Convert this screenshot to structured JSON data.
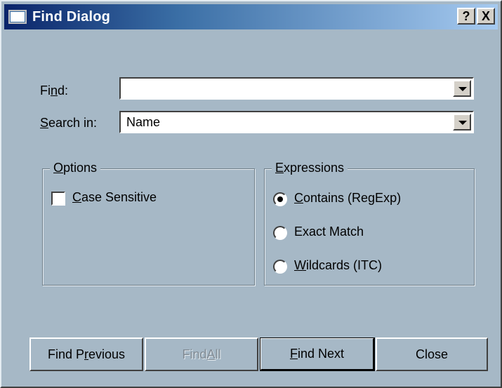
{
  "window": {
    "title": "Find Dialog",
    "help_glyph": "?",
    "close_glyph": "X"
  },
  "find": {
    "label_pre": "Fi",
    "label_accel": "n",
    "label_post": "d:",
    "value": ""
  },
  "search_in": {
    "label_pre": "",
    "label_accel": "S",
    "label_post": "earch in:",
    "value": "Name"
  },
  "options": {
    "title_accel": "O",
    "title_post": "ptions",
    "case_sensitive": {
      "label_accel": "C",
      "label_post": "ase Sensitive",
      "checked": false
    }
  },
  "expressions": {
    "title_accel": "E",
    "title_post": "xpressions",
    "items": [
      {
        "accel": "C",
        "rest": "ontains (RegExp)",
        "selected": true
      },
      {
        "accel": "",
        "rest": "Exact Match",
        "selected": false
      },
      {
        "accel": "W",
        "rest": "ildcards (ITC)",
        "selected": false
      }
    ]
  },
  "buttons": {
    "find_previous": {
      "pre": "Find P",
      "accel": "r",
      "post": "evious"
    },
    "find_all": {
      "pre": "Find ",
      "accel": "A",
      "post": "ll",
      "enabled": false
    },
    "find_next": {
      "pre": "",
      "accel": "F",
      "post": "ind Next"
    },
    "close": {
      "pre": "Close",
      "accel": "",
      "post": ""
    }
  },
  "colors": {
    "dialog_bg": "#a6b8c6",
    "title_start": "#0a246a",
    "title_end": "#a6caf0"
  }
}
